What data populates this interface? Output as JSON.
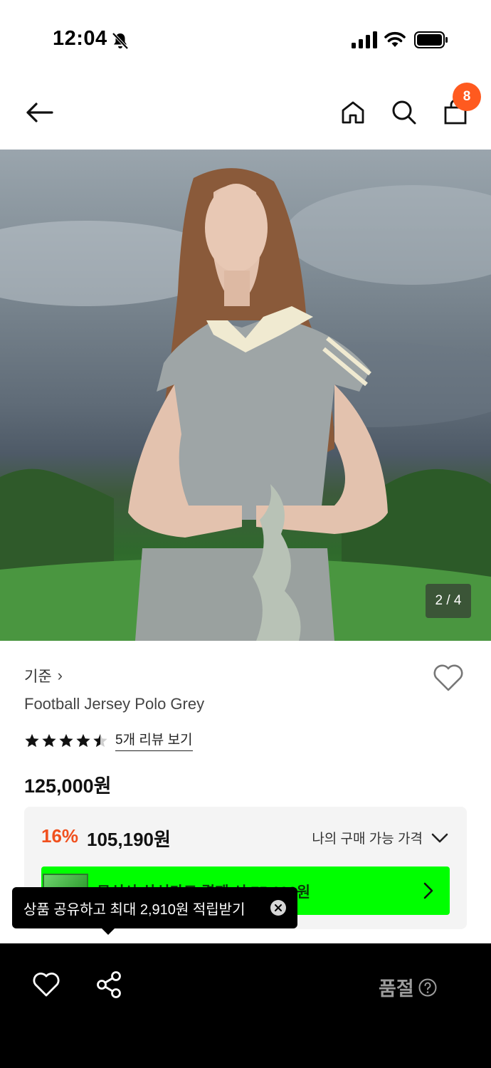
{
  "status_bar": {
    "time": "12:04"
  },
  "header": {
    "cart_count": "8"
  },
  "hero": {
    "page_indicator": "2 / 4"
  },
  "product": {
    "brand": "기준",
    "brand_chevron": "›",
    "name": "Football Jersey Polo Grey",
    "rating": 4.5,
    "review_link": "5개 리뷰 보기",
    "price": "125,000원"
  },
  "price_box": {
    "discount_rate": "16%",
    "discount_price": "105,190원",
    "my_price_label": "나의 구매 가능 가격",
    "card_banner_text": "무신사 삼성카드 결제 시 75,190원"
  },
  "tooltip": {
    "text": "상품 공유하고 최대 2,910원 적립받기"
  },
  "bottom_bar": {
    "sold_out_label": "품절"
  },
  "colors": {
    "accent_orange": "#f0501e",
    "badge_orange": "#ff5a1f",
    "banner_green": "#00ff00"
  }
}
